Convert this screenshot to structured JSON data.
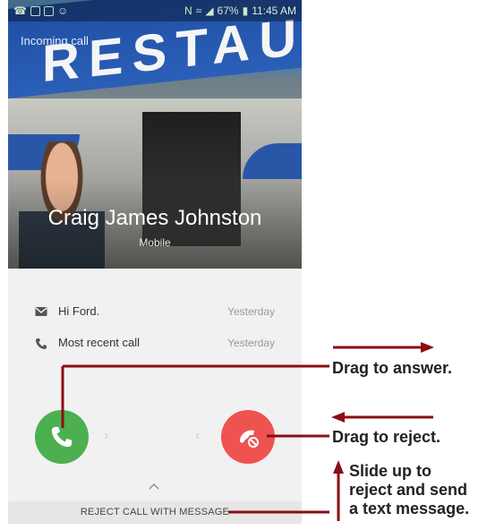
{
  "status_bar": {
    "battery": "67%",
    "time": "11:45 AM"
  },
  "call": {
    "incoming_label": "Incoming call",
    "caller_name": "Craig James Johnston",
    "caller_type": "Mobile",
    "sign_text": "RESTAUR"
  },
  "log": [
    {
      "icon": "message-icon",
      "text": "Hi Ford.",
      "time": "Yesterday"
    },
    {
      "icon": "phone-icon",
      "text": "Most recent call",
      "time": "Yesterday"
    }
  ],
  "actions": {
    "reject_with_message": "REJECT CALL WITH MESSAGE"
  },
  "callouts": {
    "answer": "Drag to answer.",
    "reject": "Drag to reject.",
    "slide_up": [
      "Slide up to",
      "reject and send",
      "a text message."
    ]
  },
  "colors": {
    "answer": "#4caf50",
    "reject": "#ef5350",
    "callout": "#8b0d14"
  }
}
